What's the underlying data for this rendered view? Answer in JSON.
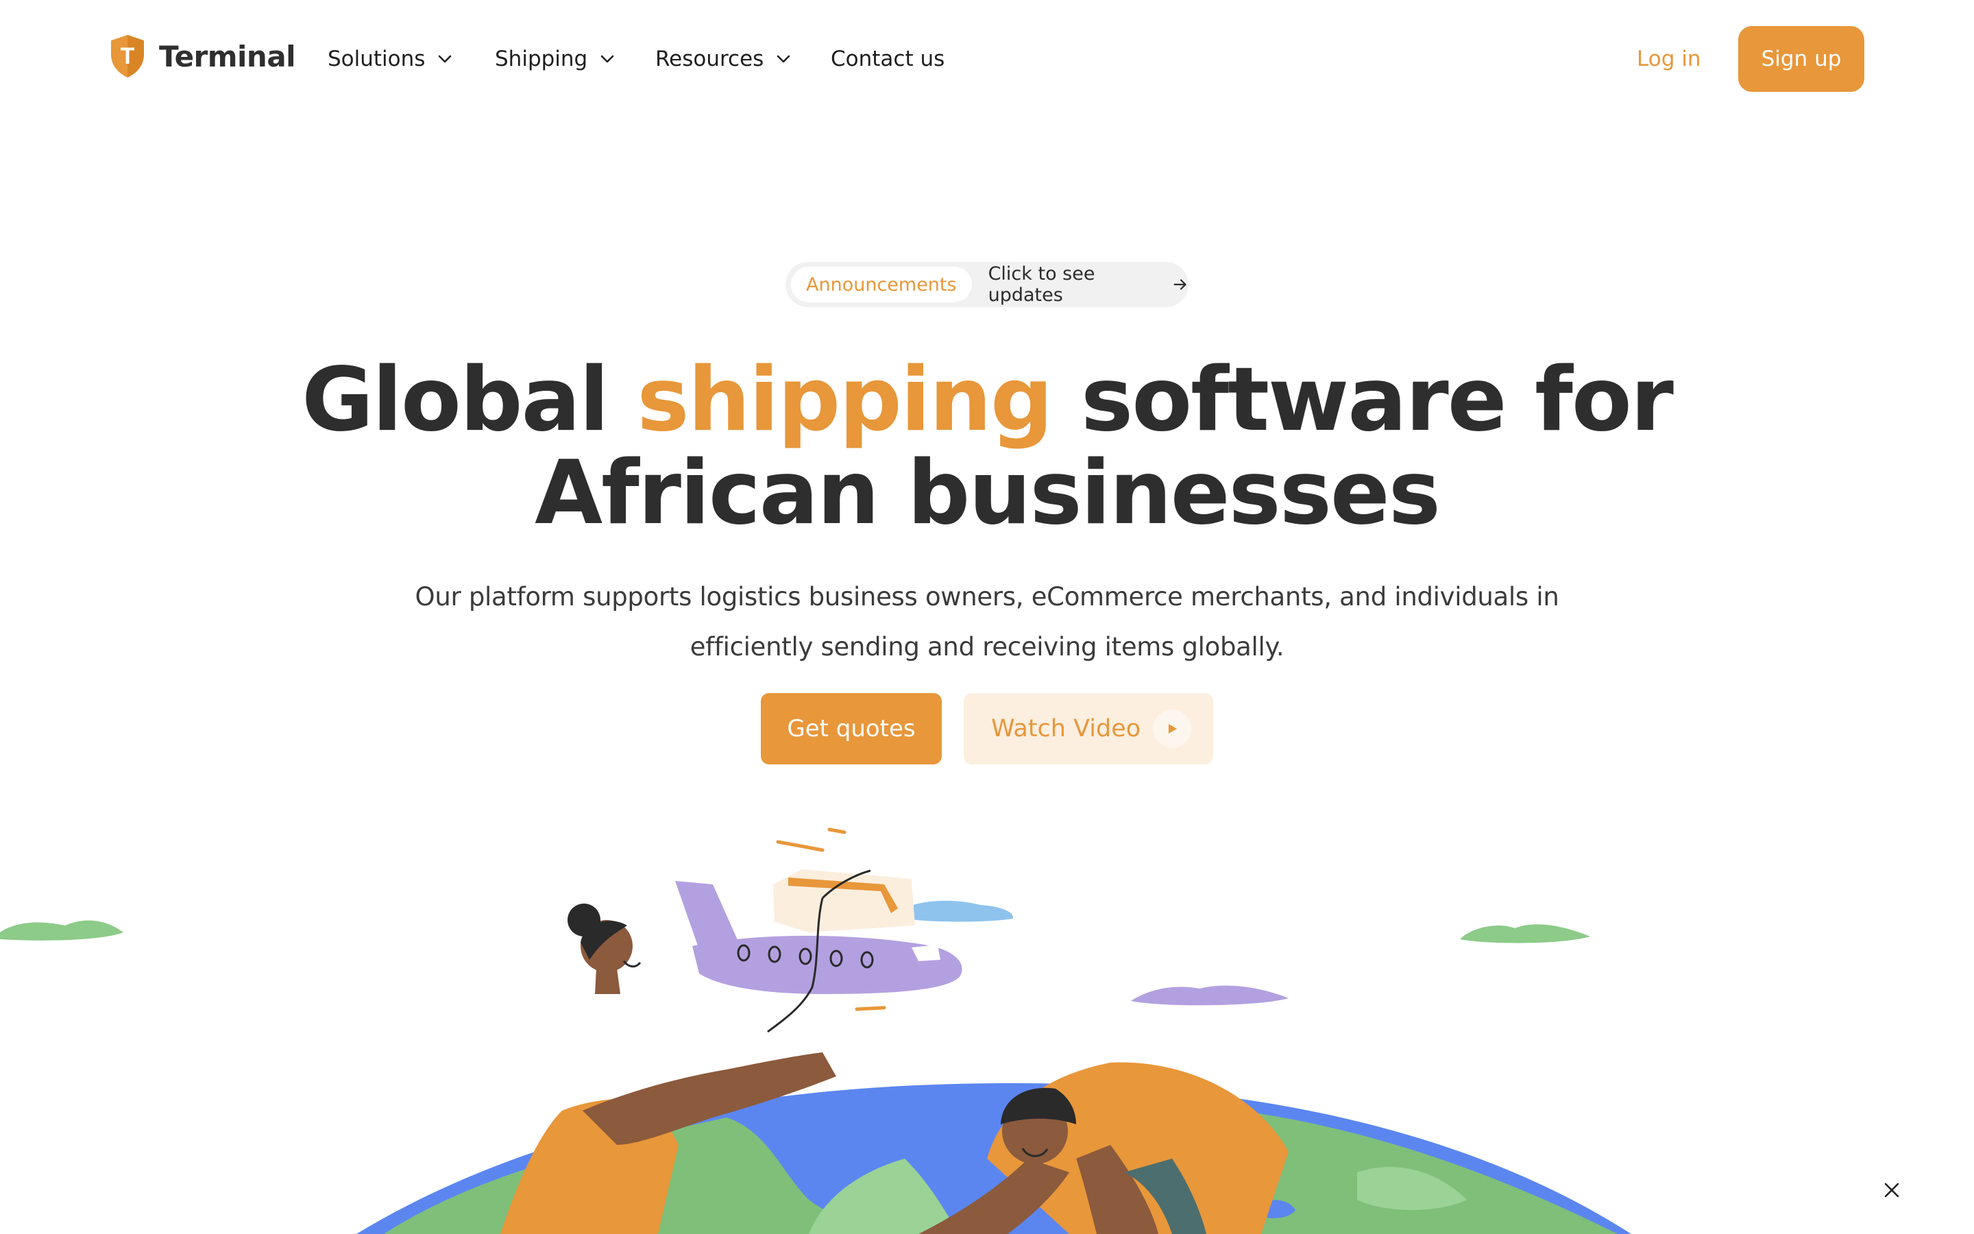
{
  "brand": {
    "name": "Terminal",
    "logo_letter": "T",
    "accent_color": "#e8973a",
    "text_color": "#2e2e2e"
  },
  "nav": {
    "items": [
      {
        "label": "Solutions",
        "has_dropdown": true
      },
      {
        "label": "Shipping",
        "has_dropdown": true
      },
      {
        "label": "Resources",
        "has_dropdown": true
      },
      {
        "label": "Contact us",
        "has_dropdown": false
      }
    ],
    "login_label": "Log in",
    "signup_label": "Sign up"
  },
  "announcement": {
    "tag": "Announcements",
    "text": "Click to see updates",
    "icon": "arrow-right-icon"
  },
  "hero": {
    "title_part1": "Global ",
    "title_accent": "shipping",
    "title_part2": " software for African businesses",
    "subtitle": "Our platform supports logistics business owners, eCommerce merchants, and individuals in efficiently sending and receiving items globally."
  },
  "cta": {
    "primary_label": "Get quotes",
    "secondary_label": "Watch Video",
    "secondary_icon": "play-icon"
  },
  "illustration": {
    "subject": "two people passing a cargo plane carrying a parcel over a globe",
    "colors": {
      "ocean": "#5b86f0",
      "land": "#7fbf7a",
      "plane": "#b3a0e0",
      "cloud_green": "#8ccb88",
      "cloud_purple": "#b3a0e0",
      "cloud_blue": "#8ec3ee",
      "shirt": "#e8973a",
      "skin": "#8c5a3c",
      "parcel": "#fbeedd"
    }
  },
  "overlay": {
    "close_icon": "close-icon"
  }
}
